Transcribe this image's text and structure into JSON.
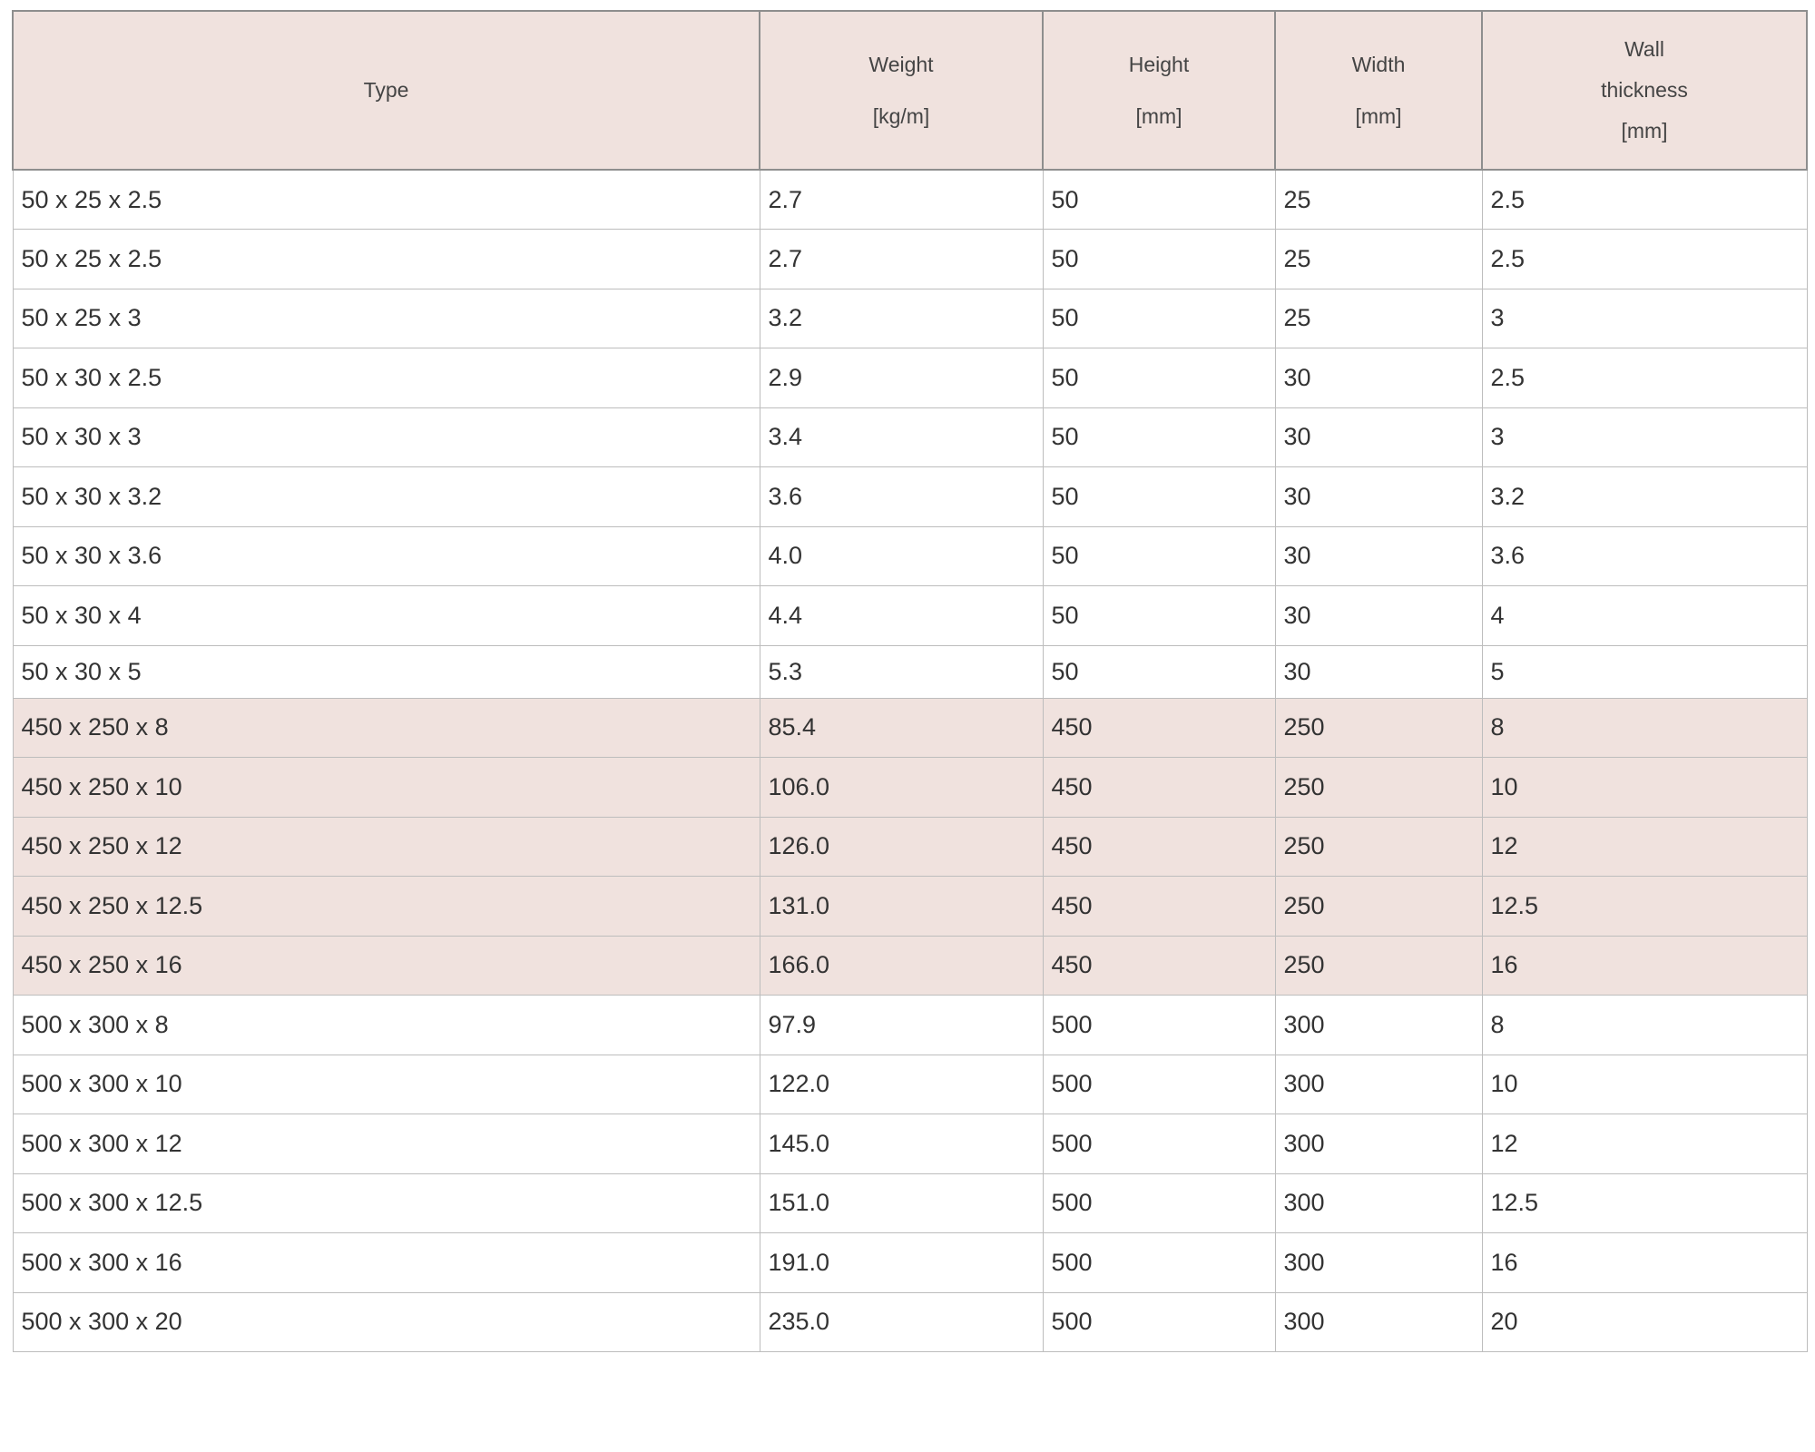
{
  "table": {
    "headers": {
      "type": [
        "Type"
      ],
      "weight": [
        "Weight",
        "[kg/m]"
      ],
      "height": [
        "Height",
        "[mm]"
      ],
      "width": [
        "Width",
        "[mm]"
      ],
      "wall": [
        "Wall",
        "thickness",
        "[mm]"
      ]
    },
    "groups": [
      {
        "shading": "plain",
        "rows": [
          [
            "50 x 25 x 2.5",
            "2.7",
            "50",
            "25",
            "2.5"
          ],
          [
            "50 x 25 x 2.5",
            "2.7",
            "50",
            "25",
            "2.5"
          ],
          [
            "50 x 25 x 3",
            "3.2",
            "50",
            "25",
            "3"
          ],
          [
            "50 x 30 x 2.5",
            "2.9",
            "50",
            "30",
            "2.5"
          ],
          [
            "50 x 30 x 3",
            "3.4",
            "50",
            "30",
            "3"
          ],
          [
            "50 x 30 x 3.2",
            "3.6",
            "50",
            "30",
            "3.2"
          ],
          [
            "50 x 30 x 3.6",
            "4.0",
            "50",
            "30",
            "3.6"
          ],
          [
            "50 x 30 x 4",
            "4.4",
            "50",
            "30",
            "4"
          ],
          [
            "50 x 30 x 5",
            "5.3",
            "50",
            "30",
            "5"
          ]
        ]
      },
      {
        "shading": "shaded",
        "rows": [
          [
            "450 x 250 x 8",
            "85.4",
            "450",
            "250",
            "8"
          ],
          [
            "450 x 250 x 10",
            "106.0",
            "450",
            "250",
            "10"
          ],
          [
            "450 x 250 x 12",
            "126.0",
            "450",
            "250",
            "12"
          ],
          [
            "450 x 250 x 12.5",
            "131.0",
            "450",
            "250",
            "12.5"
          ],
          [
            "450 x 250 x 16",
            "166.0",
            "450",
            "250",
            "16"
          ]
        ]
      },
      {
        "shading": "plain",
        "rows": [
          [
            "500 x 300 x 8",
            "97.9",
            "500",
            "300",
            "8"
          ],
          [
            "500 x 300 x 10",
            "122.0",
            "500",
            "300",
            "10"
          ],
          [
            "500 x 300 x 12",
            "145.0",
            "500",
            "300",
            "12"
          ],
          [
            "500 x 300 x 12.5",
            "151.0",
            "500",
            "300",
            "12.5"
          ],
          [
            "500 x 300 x 16",
            "191.0",
            "500",
            "300",
            "16"
          ],
          [
            "500 x 300 x 20",
            "235.0",
            "500",
            "300",
            "20"
          ]
        ]
      }
    ]
  },
  "colors": {
    "header_background": "#f0e2de",
    "shaded_row_background": "#f0e2de",
    "border": "#bdbdbd",
    "text": "#333333"
  }
}
